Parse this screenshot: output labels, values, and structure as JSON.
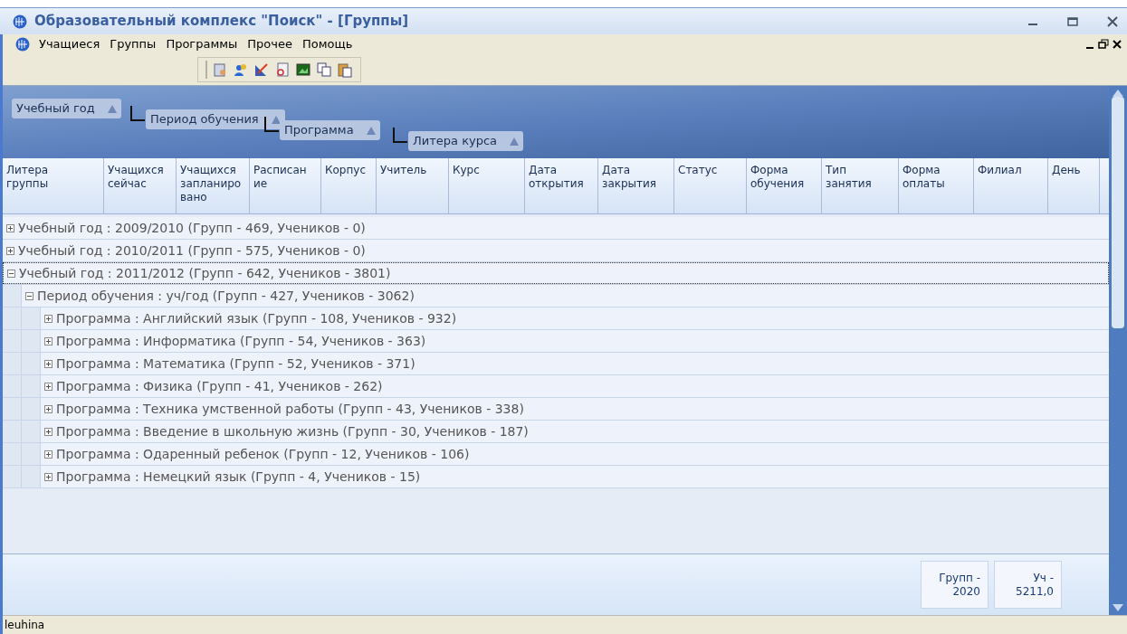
{
  "window": {
    "title": "Образовательный комплекс \"Поиск\" - [Группы]"
  },
  "menu": [
    "Учащиеся",
    "Группы",
    "Программы",
    "Прочее",
    "Помощь"
  ],
  "group_by": [
    "Учебный год",
    "Период обучения",
    "Программа",
    "Литера курса"
  ],
  "table": {
    "columns": [
      {
        "lines": [
          "Литера",
          "группы"
        ]
      },
      {
        "lines": [
          "Учащихся",
          "сейчас"
        ]
      },
      {
        "lines": [
          "Учащихся",
          "запланиро",
          "вано"
        ]
      },
      {
        "lines": [
          "Расписан",
          "ие"
        ]
      },
      {
        "lines": [
          "Корпус"
        ]
      },
      {
        "lines": [
          "Учитель"
        ]
      },
      {
        "lines": [
          "Курс"
        ]
      },
      {
        "lines": [
          "Дата",
          "открытия"
        ]
      },
      {
        "lines": [
          "Дата",
          "закрытия"
        ]
      },
      {
        "lines": [
          "Статус"
        ]
      },
      {
        "lines": [
          "Форма",
          "обучения"
        ]
      },
      {
        "lines": [
          "Тип",
          "занятия"
        ]
      },
      {
        "lines": [
          "Форма",
          "оплаты"
        ]
      },
      {
        "lines": [
          "Филиал"
        ]
      },
      {
        "lines": [
          "День"
        ]
      }
    ],
    "rows": [
      {
        "label": "Учебный год : 2009/2010 (Групп - 469, Учеников - 0)",
        "expanded": false,
        "selected": false
      },
      {
        "label": "Учебный год : 2010/2011 (Групп - 575, Учеников - 0)",
        "expanded": false,
        "selected": false
      },
      {
        "label": "Учебный год : 2011/2012 (Групп - 642, Учеников - 3801)",
        "expanded": true,
        "selected": true,
        "children": [
          {
            "label": "Период обучения : уч/год (Групп - 427, Учеников - 3062)",
            "expanded": true,
            "selected": false,
            "children": [
              {
                "label": "Программа : Английский язык (Групп - 108, Учеников - 932)",
                "expanded": false,
                "selected": false
              },
              {
                "label": "Программа : Информатика (Групп - 54, Учеников - 363)",
                "expanded": false,
                "selected": false
              },
              {
                "label": "Программа : Математика (Групп - 52, Учеников - 371)",
                "expanded": false,
                "selected": false
              },
              {
                "label": "Программа : Физика (Групп - 41, Учеников - 262)",
                "expanded": false,
                "selected": false
              },
              {
                "label": "Программа : Техника умственной работы (Групп - 43, Учеников - 338)",
                "expanded": false,
                "selected": false
              },
              {
                "label": "Программа : Введение в школьную жизнь (Групп - 30, Учеников - 187)",
                "expanded": false,
                "selected": false
              },
              {
                "label": "Программа : Одаренный ребенок (Групп - 12, Учеников - 106)",
                "expanded": false,
                "selected": false
              },
              {
                "label": "Программа : Немецкий язык (Групп - 4, Учеников - 15)",
                "expanded": false,
                "selected": false
              }
            ]
          }
        ]
      }
    ]
  },
  "totals": [
    {
      "label": "Групп -",
      "value": "2020"
    },
    {
      "label": "Уч -",
      "value": "5211,0"
    }
  ],
  "status_bar": {
    "user": "leuhina"
  }
}
